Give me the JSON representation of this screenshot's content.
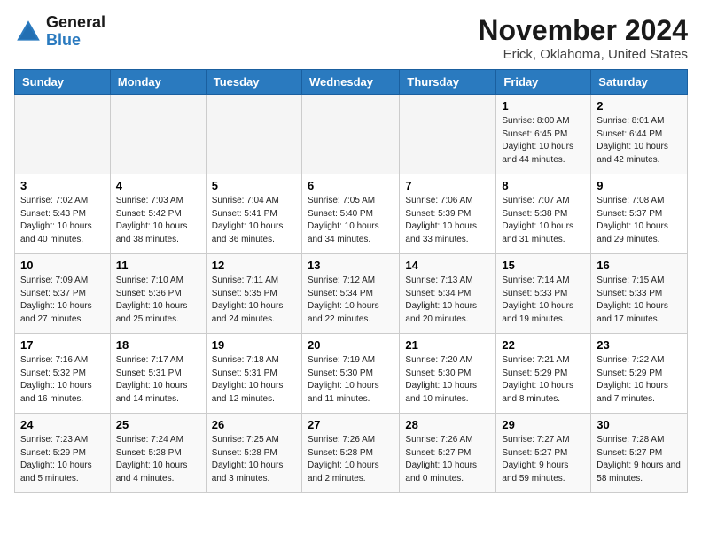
{
  "header": {
    "logo_line1": "General",
    "logo_line2": "Blue",
    "month_title": "November 2024",
    "subtitle": "Erick, Oklahoma, United States"
  },
  "weekdays": [
    "Sunday",
    "Monday",
    "Tuesday",
    "Wednesday",
    "Thursday",
    "Friday",
    "Saturday"
  ],
  "weeks": [
    [
      {
        "day": "",
        "info": ""
      },
      {
        "day": "",
        "info": ""
      },
      {
        "day": "",
        "info": ""
      },
      {
        "day": "",
        "info": ""
      },
      {
        "day": "",
        "info": ""
      },
      {
        "day": "1",
        "info": "Sunrise: 8:00 AM\nSunset: 6:45 PM\nDaylight: 10 hours and 44 minutes."
      },
      {
        "day": "2",
        "info": "Sunrise: 8:01 AM\nSunset: 6:44 PM\nDaylight: 10 hours and 42 minutes."
      }
    ],
    [
      {
        "day": "3",
        "info": "Sunrise: 7:02 AM\nSunset: 5:43 PM\nDaylight: 10 hours and 40 minutes."
      },
      {
        "day": "4",
        "info": "Sunrise: 7:03 AM\nSunset: 5:42 PM\nDaylight: 10 hours and 38 minutes."
      },
      {
        "day": "5",
        "info": "Sunrise: 7:04 AM\nSunset: 5:41 PM\nDaylight: 10 hours and 36 minutes."
      },
      {
        "day": "6",
        "info": "Sunrise: 7:05 AM\nSunset: 5:40 PM\nDaylight: 10 hours and 34 minutes."
      },
      {
        "day": "7",
        "info": "Sunrise: 7:06 AM\nSunset: 5:39 PM\nDaylight: 10 hours and 33 minutes."
      },
      {
        "day": "8",
        "info": "Sunrise: 7:07 AM\nSunset: 5:38 PM\nDaylight: 10 hours and 31 minutes."
      },
      {
        "day": "9",
        "info": "Sunrise: 7:08 AM\nSunset: 5:37 PM\nDaylight: 10 hours and 29 minutes."
      }
    ],
    [
      {
        "day": "10",
        "info": "Sunrise: 7:09 AM\nSunset: 5:37 PM\nDaylight: 10 hours and 27 minutes."
      },
      {
        "day": "11",
        "info": "Sunrise: 7:10 AM\nSunset: 5:36 PM\nDaylight: 10 hours and 25 minutes."
      },
      {
        "day": "12",
        "info": "Sunrise: 7:11 AM\nSunset: 5:35 PM\nDaylight: 10 hours and 24 minutes."
      },
      {
        "day": "13",
        "info": "Sunrise: 7:12 AM\nSunset: 5:34 PM\nDaylight: 10 hours and 22 minutes."
      },
      {
        "day": "14",
        "info": "Sunrise: 7:13 AM\nSunset: 5:34 PM\nDaylight: 10 hours and 20 minutes."
      },
      {
        "day": "15",
        "info": "Sunrise: 7:14 AM\nSunset: 5:33 PM\nDaylight: 10 hours and 19 minutes."
      },
      {
        "day": "16",
        "info": "Sunrise: 7:15 AM\nSunset: 5:33 PM\nDaylight: 10 hours and 17 minutes."
      }
    ],
    [
      {
        "day": "17",
        "info": "Sunrise: 7:16 AM\nSunset: 5:32 PM\nDaylight: 10 hours and 16 minutes."
      },
      {
        "day": "18",
        "info": "Sunrise: 7:17 AM\nSunset: 5:31 PM\nDaylight: 10 hours and 14 minutes."
      },
      {
        "day": "19",
        "info": "Sunrise: 7:18 AM\nSunset: 5:31 PM\nDaylight: 10 hours and 12 minutes."
      },
      {
        "day": "20",
        "info": "Sunrise: 7:19 AM\nSunset: 5:30 PM\nDaylight: 10 hours and 11 minutes."
      },
      {
        "day": "21",
        "info": "Sunrise: 7:20 AM\nSunset: 5:30 PM\nDaylight: 10 hours and 10 minutes."
      },
      {
        "day": "22",
        "info": "Sunrise: 7:21 AM\nSunset: 5:29 PM\nDaylight: 10 hours and 8 minutes."
      },
      {
        "day": "23",
        "info": "Sunrise: 7:22 AM\nSunset: 5:29 PM\nDaylight: 10 hours and 7 minutes."
      }
    ],
    [
      {
        "day": "24",
        "info": "Sunrise: 7:23 AM\nSunset: 5:29 PM\nDaylight: 10 hours and 5 minutes."
      },
      {
        "day": "25",
        "info": "Sunrise: 7:24 AM\nSunset: 5:28 PM\nDaylight: 10 hours and 4 minutes."
      },
      {
        "day": "26",
        "info": "Sunrise: 7:25 AM\nSunset: 5:28 PM\nDaylight: 10 hours and 3 minutes."
      },
      {
        "day": "27",
        "info": "Sunrise: 7:26 AM\nSunset: 5:28 PM\nDaylight: 10 hours and 2 minutes."
      },
      {
        "day": "28",
        "info": "Sunrise: 7:26 AM\nSunset: 5:27 PM\nDaylight: 10 hours and 0 minutes."
      },
      {
        "day": "29",
        "info": "Sunrise: 7:27 AM\nSunset: 5:27 PM\nDaylight: 9 hours and 59 minutes."
      },
      {
        "day": "30",
        "info": "Sunrise: 7:28 AM\nSunset: 5:27 PM\nDaylight: 9 hours and 58 minutes."
      }
    ]
  ]
}
